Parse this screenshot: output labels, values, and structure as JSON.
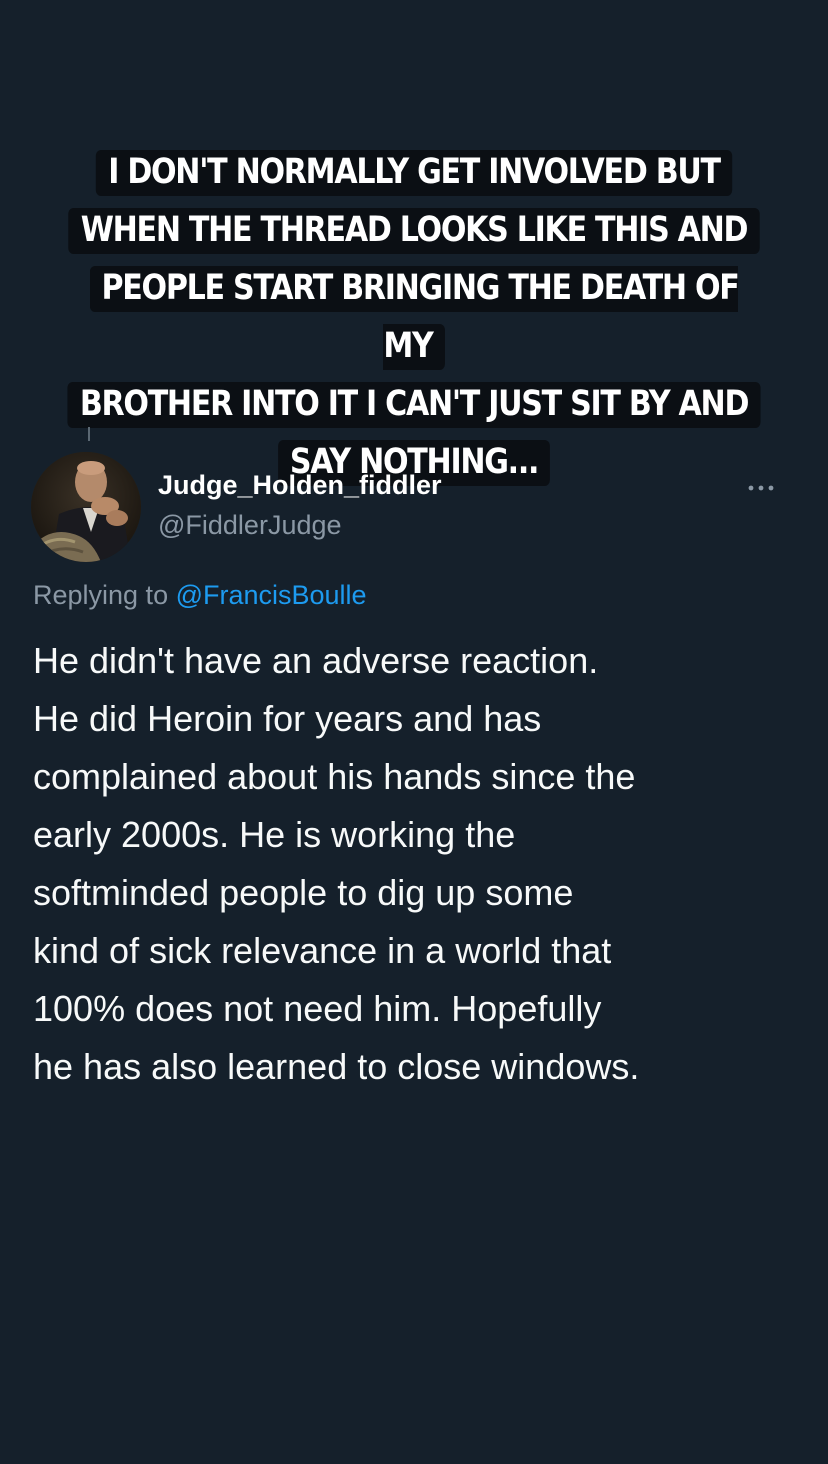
{
  "caption": {
    "lines": [
      "I DON'T NORMALLY GET INVOLVED BUT",
      "WHEN THE THREAD LOOKS LIKE THIS AND",
      "PEOPLE START BRINGING THE DEATH OF MY",
      "BROTHER INTO IT I CAN'T JUST SIT BY AND",
      "SAY NOTHING..."
    ]
  },
  "tweet": {
    "author_name": "Judge_Holden_fiddler",
    "author_handle": "@FiddlerJudge",
    "avatar_icon": "avatar-photo",
    "more_icon": "more-options-icon",
    "replying_prefix": "Replying to ",
    "replying_to": "@FrancisBoulle",
    "text_lines": [
      "He didn't have an adverse reaction.",
      "He did Heroin for years and has",
      "complained about his hands since the",
      "early 2000s. He is working the",
      "softminded people to dig up some",
      "kind of sick relevance in a world that",
      "100% does not need him. Hopefully",
      "he has also learned to close windows."
    ]
  },
  "colors": {
    "background": "#15202b",
    "caption_bg": "#0b0f14",
    "text_primary": "#f7f9f9",
    "text_secondary": "#8b98a5",
    "link": "#1d9bf0"
  }
}
